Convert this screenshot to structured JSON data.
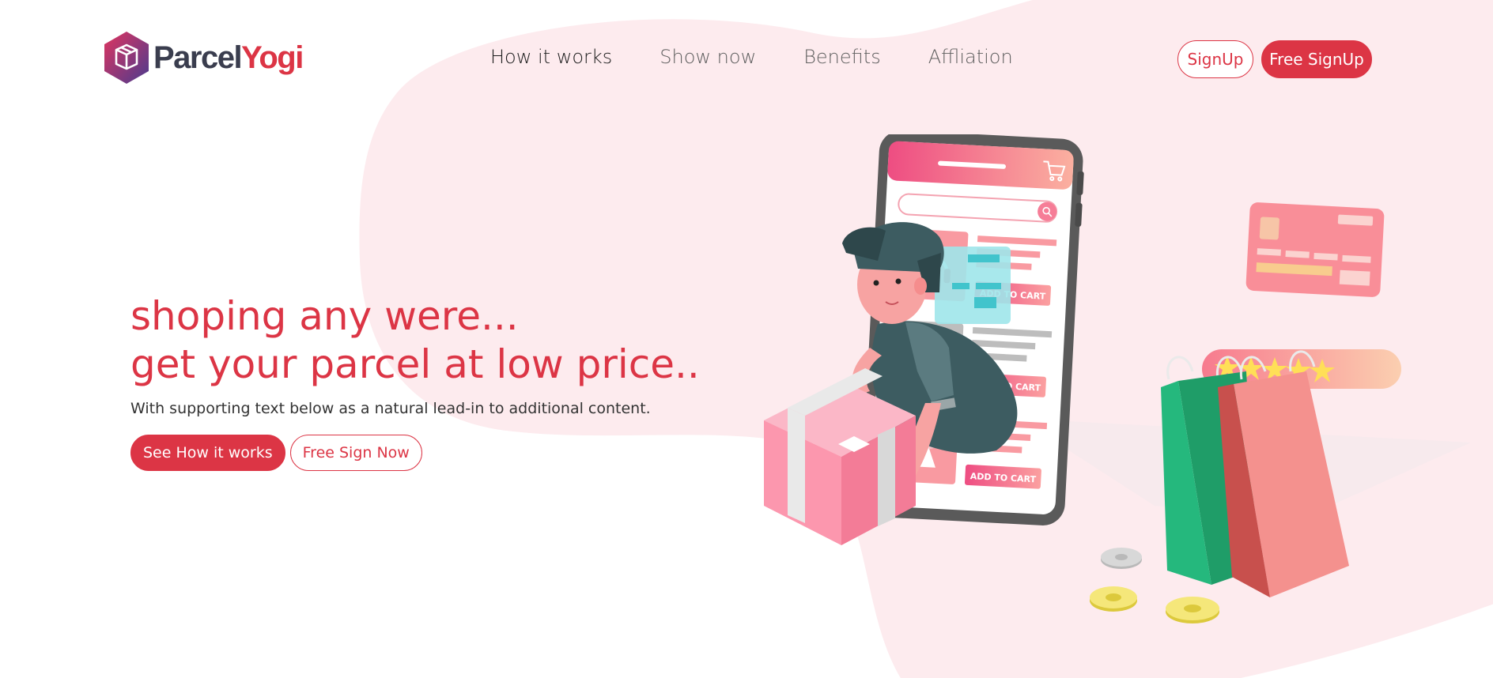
{
  "brand": {
    "name_part1": "Parcel",
    "name_part2": "Yogi",
    "icon": "box-hexagon-icon",
    "accent": "#dc3545",
    "dark": "#3a3d4e"
  },
  "nav": {
    "items": [
      {
        "label": "How it works",
        "active": true
      },
      {
        "label": "Show now",
        "active": false
      },
      {
        "label": "Benefits",
        "active": false
      },
      {
        "label": "Affliation",
        "active": false
      }
    ]
  },
  "header_buttons": {
    "signup": "SignUp",
    "free_signup": "Free SignUp"
  },
  "hero": {
    "line1": "shoping any were...",
    "line2": "get your parcel at low price..",
    "subtext": "With supporting text below as a natural lead-in to additional content.",
    "primary_button": "See How it works",
    "secondary_button": "Free Sign Now"
  },
  "illustration": {
    "add_to_cart_1": "ADD TO CART",
    "add_to_cart_2": "ADD TO CART",
    "add_to_cart_3": "ADD TO CART",
    "icons": [
      "delivery-person",
      "parcel-box-icon",
      "smartphone-icon",
      "cart-icon",
      "search-icon",
      "headphones-icon",
      "shoe-icon",
      "dress-icon",
      "credit-card-icon",
      "star-icon",
      "shopping-bag-icon",
      "coin-icon"
    ],
    "rating_stars": 5
  },
  "colors": {
    "blob": "#fdebee",
    "pink": "#f58da0",
    "teal": "#3a5a60",
    "green": "#25b87d"
  }
}
